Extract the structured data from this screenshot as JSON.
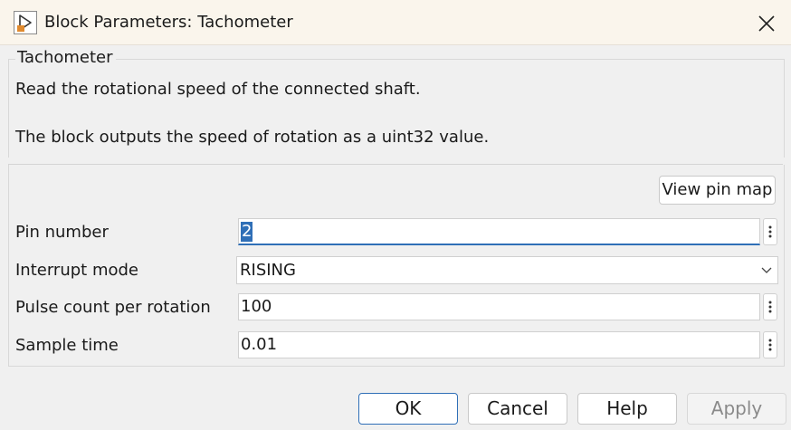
{
  "window": {
    "title": "Block Parameters: Tachometer"
  },
  "icons": {
    "app": "simulink-block-icon",
    "close": "close-icon",
    "dropdown": "chevron-down-icon",
    "more": "kebab-menu-icon"
  },
  "description": {
    "group_label": "Tachometer",
    "line1": "Read the rotational speed of the connected shaft.",
    "line2": "The block outputs the speed of rotation as a uint32 value."
  },
  "parameters": {
    "view_pin_map_label": "View pin map",
    "pin_number": {
      "label": "Pin number",
      "value": "2"
    },
    "interrupt_mode": {
      "label": "Interrupt mode",
      "value": "RISING"
    },
    "pulse_count": {
      "label": "Pulse count per rotation",
      "value": "100"
    },
    "sample_time": {
      "label": "Sample time",
      "value": "0.01"
    }
  },
  "buttons": {
    "ok": "OK",
    "cancel": "Cancel",
    "help": "Help",
    "apply": "Apply"
  },
  "colors": {
    "accent": "#2f6fb7",
    "titlebar": "#faf5ec",
    "background": "#f0f0f0"
  }
}
